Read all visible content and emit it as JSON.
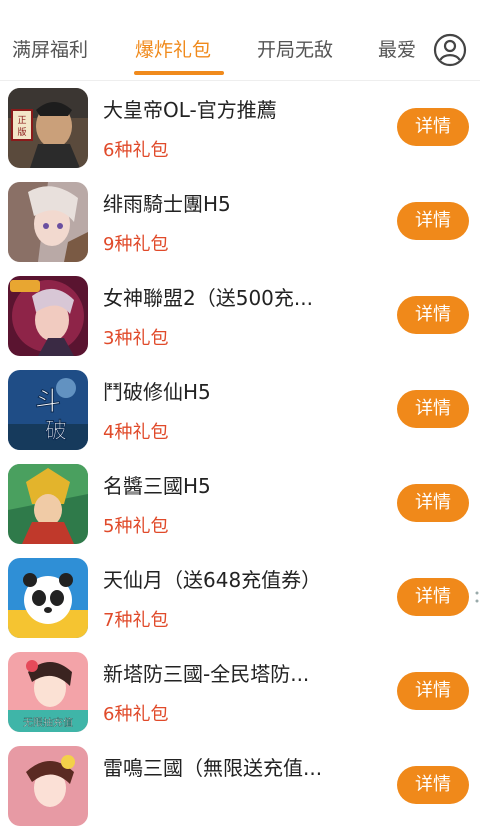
{
  "tabs": [
    {
      "label": "满屏福利",
      "active": false
    },
    {
      "label": "爆炸礼包",
      "active": true
    },
    {
      "label": "开局无敌",
      "active": false
    },
    {
      "label": "最爱",
      "active": false
    }
  ],
  "colors": {
    "accent": "#f08a1c",
    "gift_count": "#e04a2a"
  },
  "icons": {
    "profile": "user-circle-icon"
  },
  "games": [
    {
      "title": "大皇帝OL-官方推薦",
      "gifts": "6种礼包",
      "button": "详情",
      "thumb_badge": "正版"
    },
    {
      "title": "绯雨騎士團H5",
      "gifts": "9种礼包",
      "button": "详情"
    },
    {
      "title": "女神聯盟2（送500充...",
      "gifts": "3种礼包",
      "button": "详情"
    },
    {
      "title": "鬥破修仙H5",
      "gifts": "4种礼包",
      "button": "详情",
      "thumb_badge": "斗破"
    },
    {
      "title": "名醬三國H5",
      "gifts": "5种礼包",
      "button": "详情"
    },
    {
      "title": "天仙月（送648充值券）",
      "gifts": "7种礼包",
      "button": "详情"
    },
    {
      "title": "新塔防三國-全民塔防...",
      "gifts": "6种礼包",
      "button": "详情",
      "thumb_badge": "无限抽充值"
    },
    {
      "title": "雷鳴三國（無限送充值...",
      "gifts": "",
      "button": "详情"
    }
  ]
}
